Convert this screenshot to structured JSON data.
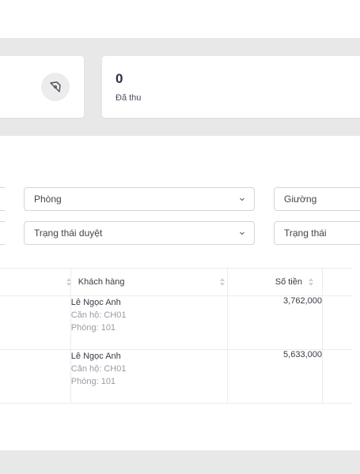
{
  "stats": {
    "collected_value": "0",
    "collected_label": "Đã thu"
  },
  "filters": {
    "room_placeholder": "Phòng",
    "bed_placeholder": "Giường",
    "approval_status_placeholder": "Trạng thái duyệt",
    "status_placeholder": "Trạng thái"
  },
  "table": {
    "columns": {
      "customer": "Khách hàng",
      "amount": "Số tiền"
    },
    "rows": [
      {
        "customer_name": "Lê Ngọc Anh",
        "apartment": "Căn hộ: CH01",
        "room": "Phòng: 101",
        "amount": "3,762,000"
      },
      {
        "customer_name": "Lê Ngọc Anh",
        "apartment": "Căn hộ: CH01",
        "room": "Phòng: 101",
        "amount": "5,633,000"
      }
    ]
  }
}
